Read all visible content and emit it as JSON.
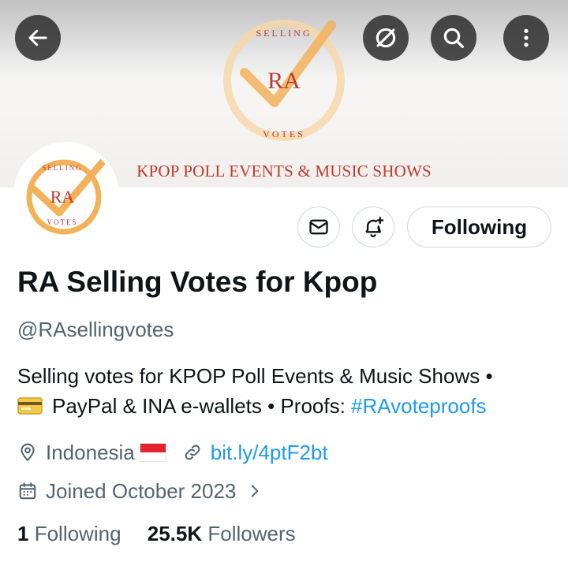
{
  "banner": {
    "logo_top_text": "SELLING",
    "logo_center_text": "RA",
    "logo_bottom_text": "VOTES",
    "tagline": "KPOP POLL EVENTS & MUSIC SHOWS"
  },
  "top_buttons": {
    "back": "back-arrow-icon",
    "grok": "grok-icon",
    "search": "search-icon",
    "more": "more-vertical-icon"
  },
  "actions": {
    "following_label": "Following"
  },
  "profile": {
    "name": "RA Selling Votes for Kpop",
    "handle": "@RAsellingvotes",
    "bio_line1": "Selling votes for KPOP Poll Events & Music Shows •",
    "bio_line2_text": "PayPal & INA e-wallets • Proofs: ",
    "bio_hashtag": "#RAvoteproofs",
    "location": "Indonesia",
    "website": "bit.ly/4ptF2bt",
    "joined": "Joined October 2023"
  },
  "stats": {
    "following_count": "1",
    "following_label": "Following",
    "followers_count": "25.5K",
    "followers_label": "Followers"
  },
  "colors": {
    "link": "#1d9bf0",
    "secondary_text": "#536471",
    "logo_orange": "#f3b15a",
    "logo_red": "#c0392b"
  }
}
